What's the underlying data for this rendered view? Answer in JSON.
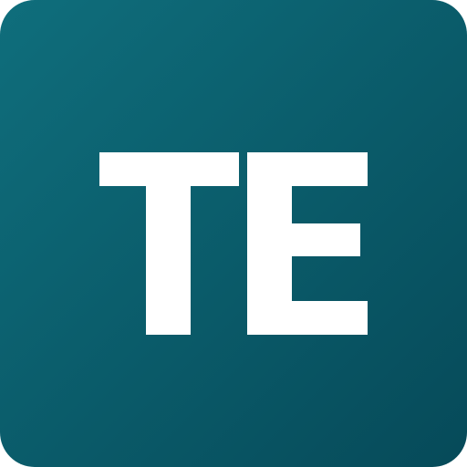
{
  "icon": {
    "monogram": "TE",
    "letters": [
      "T",
      "E"
    ],
    "background_gradient_start": "#0f6e7c",
    "background_gradient_end": "#064a59",
    "letter_color": "#ffffff"
  }
}
